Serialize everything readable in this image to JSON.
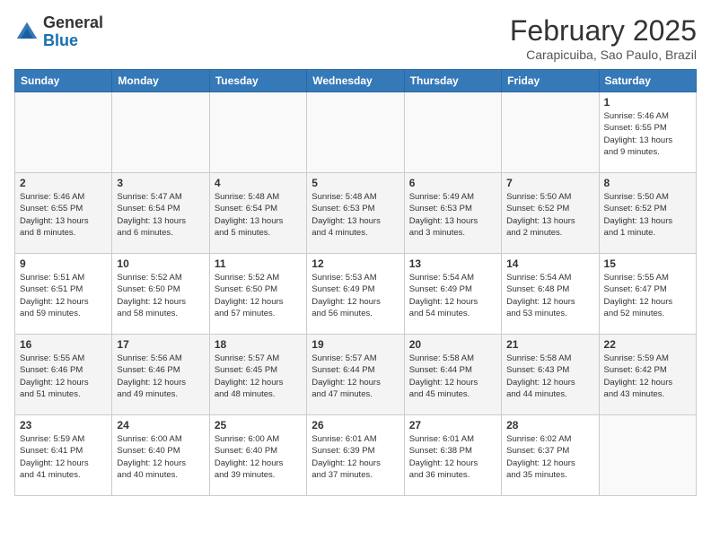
{
  "logo": {
    "general": "General",
    "blue": "Blue"
  },
  "title": "February 2025",
  "subtitle": "Carapicuiba, Sao Paulo, Brazil",
  "headers": [
    "Sunday",
    "Monday",
    "Tuesday",
    "Wednesday",
    "Thursday",
    "Friday",
    "Saturday"
  ],
  "weeks": [
    [
      {
        "day": null,
        "info": null
      },
      {
        "day": null,
        "info": null
      },
      {
        "day": null,
        "info": null
      },
      {
        "day": null,
        "info": null
      },
      {
        "day": null,
        "info": null
      },
      {
        "day": null,
        "info": null
      },
      {
        "day": "1",
        "info": "Sunrise: 5:46 AM\nSunset: 6:55 PM\nDaylight: 13 hours\nand 9 minutes."
      }
    ],
    [
      {
        "day": "2",
        "info": "Sunrise: 5:46 AM\nSunset: 6:55 PM\nDaylight: 13 hours\nand 8 minutes."
      },
      {
        "day": "3",
        "info": "Sunrise: 5:47 AM\nSunset: 6:54 PM\nDaylight: 13 hours\nand 6 minutes."
      },
      {
        "day": "4",
        "info": "Sunrise: 5:48 AM\nSunset: 6:54 PM\nDaylight: 13 hours\nand 5 minutes."
      },
      {
        "day": "5",
        "info": "Sunrise: 5:48 AM\nSunset: 6:53 PM\nDaylight: 13 hours\nand 4 minutes."
      },
      {
        "day": "6",
        "info": "Sunrise: 5:49 AM\nSunset: 6:53 PM\nDaylight: 13 hours\nand 3 minutes."
      },
      {
        "day": "7",
        "info": "Sunrise: 5:50 AM\nSunset: 6:52 PM\nDaylight: 13 hours\nand 2 minutes."
      },
      {
        "day": "8",
        "info": "Sunrise: 5:50 AM\nSunset: 6:52 PM\nDaylight: 13 hours\nand 1 minute."
      }
    ],
    [
      {
        "day": "9",
        "info": "Sunrise: 5:51 AM\nSunset: 6:51 PM\nDaylight: 12 hours\nand 59 minutes."
      },
      {
        "day": "10",
        "info": "Sunrise: 5:52 AM\nSunset: 6:50 PM\nDaylight: 12 hours\nand 58 minutes."
      },
      {
        "day": "11",
        "info": "Sunrise: 5:52 AM\nSunset: 6:50 PM\nDaylight: 12 hours\nand 57 minutes."
      },
      {
        "day": "12",
        "info": "Sunrise: 5:53 AM\nSunset: 6:49 PM\nDaylight: 12 hours\nand 56 minutes."
      },
      {
        "day": "13",
        "info": "Sunrise: 5:54 AM\nSunset: 6:49 PM\nDaylight: 12 hours\nand 54 minutes."
      },
      {
        "day": "14",
        "info": "Sunrise: 5:54 AM\nSunset: 6:48 PM\nDaylight: 12 hours\nand 53 minutes."
      },
      {
        "day": "15",
        "info": "Sunrise: 5:55 AM\nSunset: 6:47 PM\nDaylight: 12 hours\nand 52 minutes."
      }
    ],
    [
      {
        "day": "16",
        "info": "Sunrise: 5:55 AM\nSunset: 6:46 PM\nDaylight: 12 hours\nand 51 minutes."
      },
      {
        "day": "17",
        "info": "Sunrise: 5:56 AM\nSunset: 6:46 PM\nDaylight: 12 hours\nand 49 minutes."
      },
      {
        "day": "18",
        "info": "Sunrise: 5:57 AM\nSunset: 6:45 PM\nDaylight: 12 hours\nand 48 minutes."
      },
      {
        "day": "19",
        "info": "Sunrise: 5:57 AM\nSunset: 6:44 PM\nDaylight: 12 hours\nand 47 minutes."
      },
      {
        "day": "20",
        "info": "Sunrise: 5:58 AM\nSunset: 6:44 PM\nDaylight: 12 hours\nand 45 minutes."
      },
      {
        "day": "21",
        "info": "Sunrise: 5:58 AM\nSunset: 6:43 PM\nDaylight: 12 hours\nand 44 minutes."
      },
      {
        "day": "22",
        "info": "Sunrise: 5:59 AM\nSunset: 6:42 PM\nDaylight: 12 hours\nand 43 minutes."
      }
    ],
    [
      {
        "day": "23",
        "info": "Sunrise: 5:59 AM\nSunset: 6:41 PM\nDaylight: 12 hours\nand 41 minutes."
      },
      {
        "day": "24",
        "info": "Sunrise: 6:00 AM\nSunset: 6:40 PM\nDaylight: 12 hours\nand 40 minutes."
      },
      {
        "day": "25",
        "info": "Sunrise: 6:00 AM\nSunset: 6:40 PM\nDaylight: 12 hours\nand 39 minutes."
      },
      {
        "day": "26",
        "info": "Sunrise: 6:01 AM\nSunset: 6:39 PM\nDaylight: 12 hours\nand 37 minutes."
      },
      {
        "day": "27",
        "info": "Sunrise: 6:01 AM\nSunset: 6:38 PM\nDaylight: 12 hours\nand 36 minutes."
      },
      {
        "day": "28",
        "info": "Sunrise: 6:02 AM\nSunset: 6:37 PM\nDaylight: 12 hours\nand 35 minutes."
      },
      {
        "day": null,
        "info": null
      }
    ]
  ]
}
